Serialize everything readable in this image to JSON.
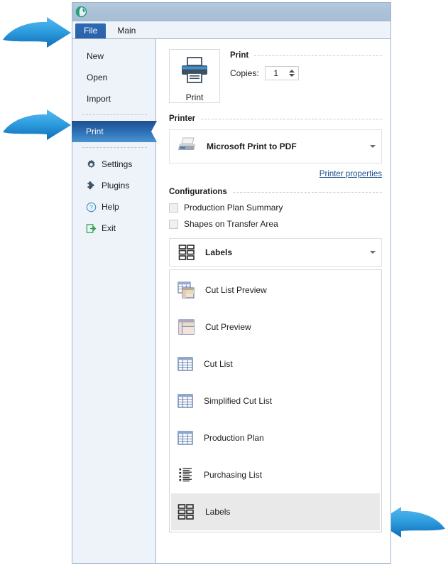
{
  "window": {
    "app_icon": "globe-icon",
    "tabs": [
      {
        "label": "File",
        "selected": true
      },
      {
        "label": "Main",
        "selected": false
      }
    ]
  },
  "sidebar": {
    "items": [
      {
        "label": "New",
        "icon": null,
        "selected": false
      },
      {
        "label": "Open",
        "icon": null,
        "selected": false
      },
      {
        "label": "Import",
        "icon": null,
        "selected": false
      },
      {
        "label": "Print",
        "icon": null,
        "selected": true
      },
      {
        "label": "Settings",
        "icon": "gear-icon",
        "selected": false
      },
      {
        "label": "Plugins",
        "icon": "puzzle-icon",
        "selected": false
      },
      {
        "label": "Help",
        "icon": "question-icon",
        "selected": false
      },
      {
        "label": "Exit",
        "icon": "exit-icon",
        "selected": false
      }
    ]
  },
  "main": {
    "print_button": {
      "label": "Print",
      "icon": "printer-icon"
    },
    "print_group": {
      "title": "Print",
      "copies_label": "Copies:",
      "copies_value": "1"
    },
    "printer_group": {
      "title": "Printer",
      "selected_printer": "Microsoft Print to PDF",
      "printer_icon": "printer-device-icon",
      "properties_link": "Printer properties"
    },
    "configurations": {
      "title": "Configurations",
      "checkboxes": [
        {
          "label": "Production Plan Summary",
          "checked": false
        },
        {
          "label": "Shapes on Transfer Area",
          "checked": false
        }
      ],
      "combo": {
        "value": "Labels",
        "icon": "labels-icon"
      },
      "options": [
        {
          "label": "Cut List Preview",
          "icon": "cut-list-preview-icon",
          "highlighted": false
        },
        {
          "label": "Cut Preview",
          "icon": "cut-preview-icon",
          "highlighted": false
        },
        {
          "label": "Cut List",
          "icon": "table-icon",
          "highlighted": false
        },
        {
          "label": "Simplified Cut List",
          "icon": "table-icon",
          "highlighted": false
        },
        {
          "label": "Production Plan",
          "icon": "table-icon",
          "highlighted": false
        },
        {
          "label": "Purchasing List",
          "icon": "list-icon",
          "highlighted": false
        },
        {
          "label": "Labels",
          "icon": "labels-icon",
          "highlighted": true
        }
      ]
    }
  },
  "annotations": {
    "arrows": [
      {
        "name": "arrow-to-file-tab",
        "direction": "right"
      },
      {
        "name": "arrow-to-print-menu",
        "direction": "right"
      },
      {
        "name": "arrow-to-labels-option",
        "direction": "left"
      }
    ]
  },
  "colors": {
    "accent": "#2a62a8",
    "titlebar": "#abc1d7",
    "sidebar_bg": "#eef3fa",
    "link": "#1b4f8a",
    "arrow": "#1f8ad6"
  }
}
